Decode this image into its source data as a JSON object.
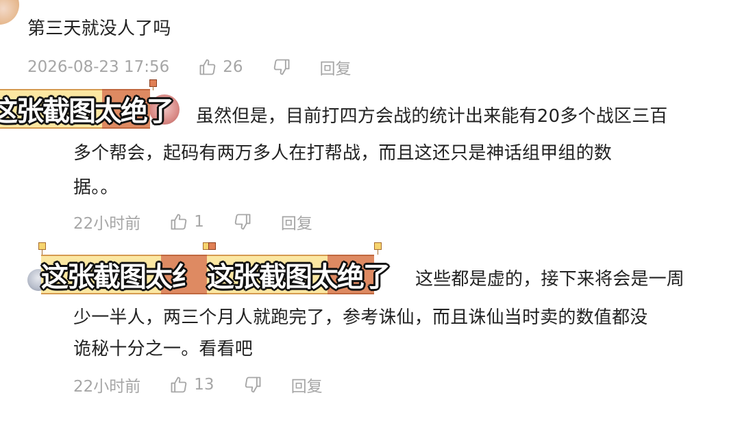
{
  "comments": [
    {
      "text": "第三天就没人了吗",
      "time": "2026-08-23 17:56",
      "likes": "26",
      "reply": "回复"
    },
    {
      "lines": [
        "虽然但是，目前打四方会战的统计出来能有20多个战区三百",
        "多个帮会，起码有两万多人在打帮战，而且这还只是神话组甲组的数",
        "据。。"
      ],
      "time": "22小时前",
      "likes": "1",
      "reply": "回复"
    },
    {
      "lines": [
        "这些都是虚的，接下来将会是一周",
        "少一半人，两三个月人就跑完了，参考诛仙，而且诛仙当时卖的数值都没",
        "诡秘十分之一。看看吧"
      ],
      "time": "22小时前",
      "likes": "13",
      "reply": "回复"
    }
  ],
  "overlays": {
    "caption_full": "这张截图太绝了",
    "caption_cut": "这张截图太纟"
  },
  "colors": {
    "text": "#222222",
    "meta": "#a6a6a6",
    "overlay_light": "#fbe7a2",
    "overlay_orange": "#de8a62"
  },
  "icons": [
    "thumbs-up-icon",
    "thumbs-down-icon"
  ]
}
